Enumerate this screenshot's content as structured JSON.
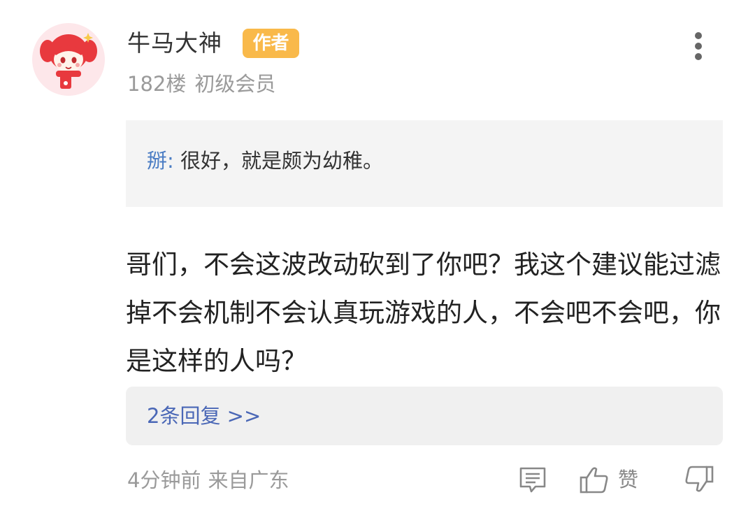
{
  "post": {
    "username": "牛马大神",
    "badge": "作者",
    "floor": "182楼",
    "level": "初级会员"
  },
  "quote": {
    "author": "掰",
    "separator": ": ",
    "text": "很好，就是颇为幼稚。"
  },
  "content": "哥们，不会这波改动砍到了你吧？我这个建议能过滤掉不会机制不会认真玩游戏的人，不会吧不会吧，你是这样的人吗？",
  "replies": {
    "label": "2条回复 >>"
  },
  "footer": {
    "time": "4分钟前",
    "location": "来自广东",
    "like_label": "赞"
  },
  "icons": {
    "more": "more-vertical-icon",
    "comment": "comment-icon",
    "like": "thumbs-up-icon",
    "dislike": "thumbs-down-icon"
  },
  "colors": {
    "badge": "#f9b94a",
    "quote_author": "#4a7cc3",
    "reply_link": "#4a67b6",
    "avatar_bg": "#fde7ea"
  }
}
